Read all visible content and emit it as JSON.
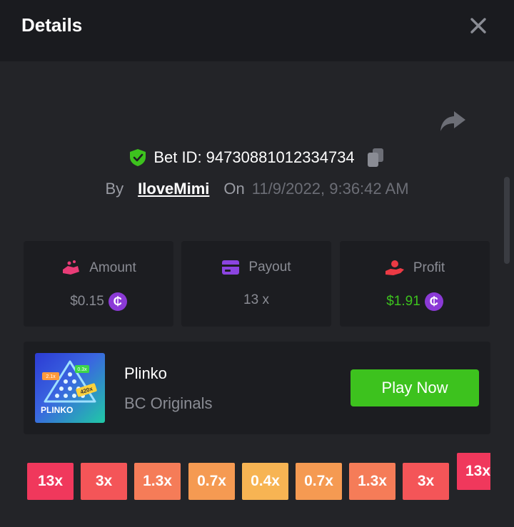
{
  "header": {
    "title": "Details"
  },
  "bet": {
    "id_label": "Bet ID: 94730881012334734",
    "by_label": "By",
    "username": "IloveMimi",
    "on_label": "On",
    "datetime": "11/9/2022, 9:36:42 AM"
  },
  "stats": {
    "amount": {
      "label": "Amount",
      "value": "$0.15",
      "coin": "₵"
    },
    "payout": {
      "label": "Payout",
      "value": "13 x"
    },
    "profit": {
      "label": "Profit",
      "value": "$1.91",
      "coin": "₵"
    }
  },
  "game": {
    "name": "Plinko",
    "provider": "BC Originals",
    "play_label": "Play Now",
    "thumb_title": "PLINKO",
    "thumb_badges": [
      "2.1x",
      "0.3x",
      "420x"
    ]
  },
  "multipliers": [
    {
      "label": "13x",
      "color": "#f0385c"
    },
    {
      "label": "3x",
      "color": "#f45558"
    },
    {
      "label": "1.3x",
      "color": "#f57c58"
    },
    {
      "label": "0.7x",
      "color": "#f59a52"
    },
    {
      "label": "0.4x",
      "color": "#f7b453"
    },
    {
      "label": "0.7x",
      "color": "#f59a52"
    },
    {
      "label": "1.3x",
      "color": "#f57c58"
    },
    {
      "label": "3x",
      "color": "#f45558"
    }
  ],
  "multiplier_partial": "13x",
  "colors": {
    "profit_green": "#3dc21e",
    "play_button": "#3dc21e",
    "coin_purple": "#8b3ad6",
    "amount_icon": "#e83c77",
    "payout_icon": "#8b44e0",
    "profit_icon": "#ec3a44"
  },
  "icons": [
    "close-icon",
    "share-icon",
    "shield-check-icon",
    "copy-icon",
    "amount-icon",
    "payout-card-icon",
    "profit-hand-icon",
    "coin-icon"
  ]
}
